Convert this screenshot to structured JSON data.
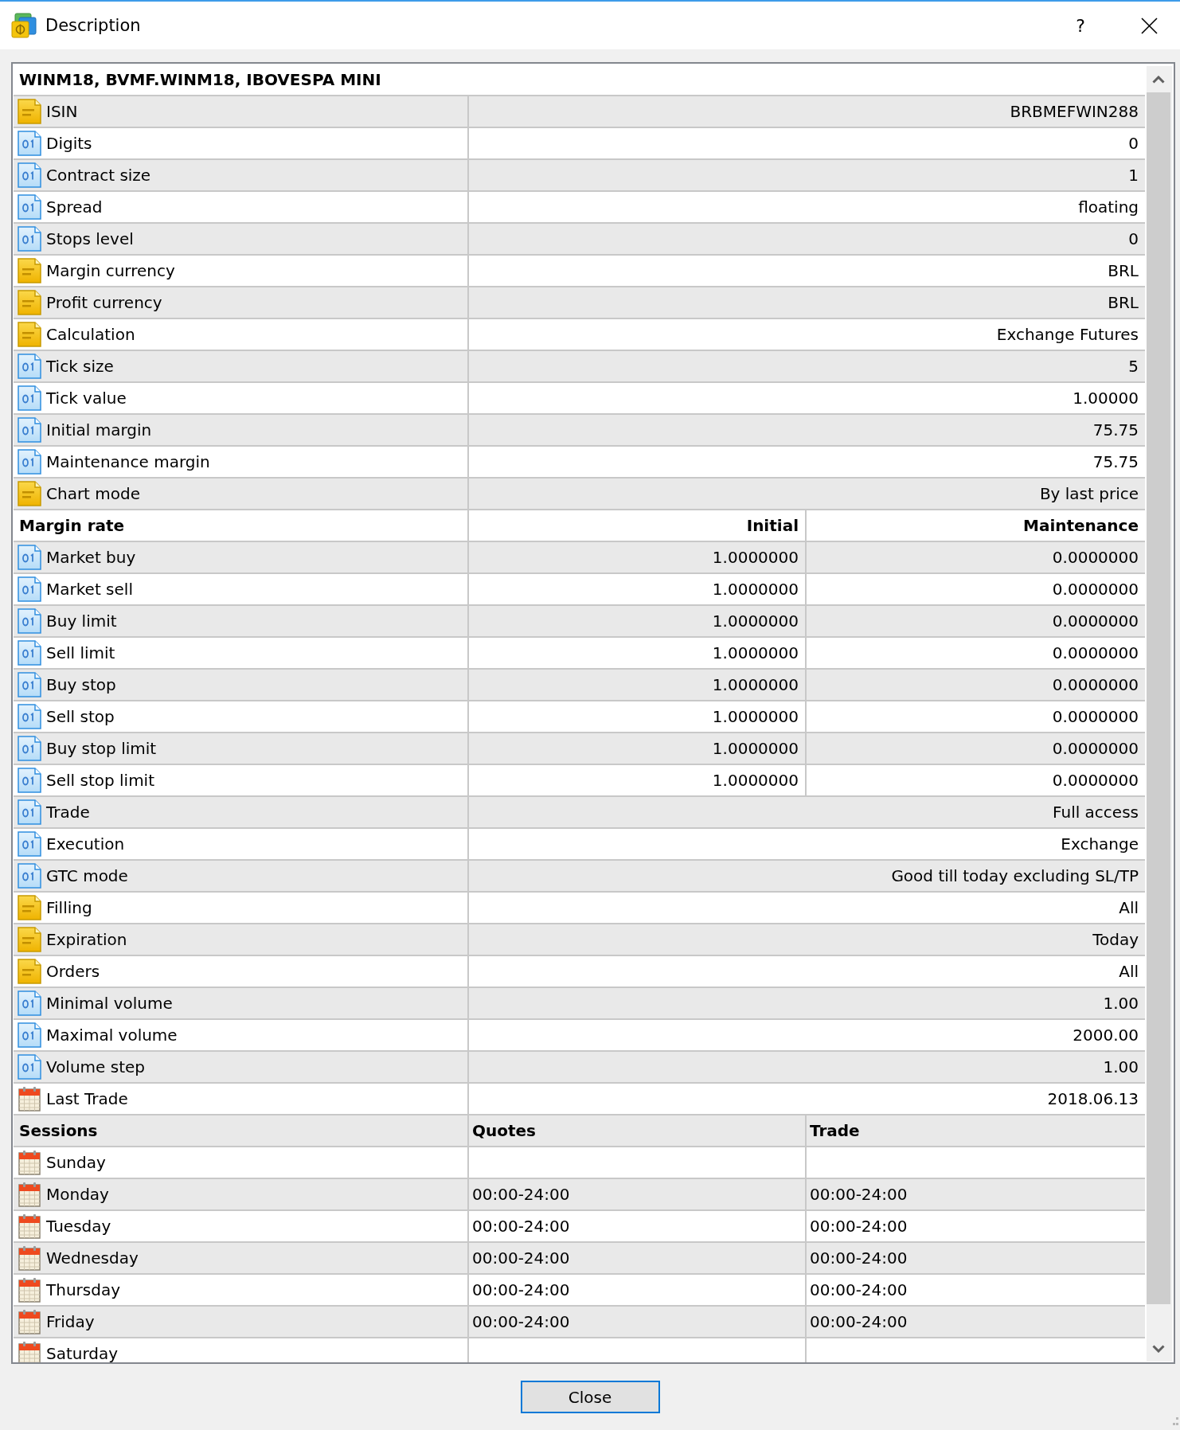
{
  "window": {
    "title": "Description",
    "help": "?"
  },
  "symbol_title": "WINM18, BVMF.WINM18, IBOVESPA MINI",
  "sections": [
    {
      "kind": "properties",
      "rows": [
        {
          "kind": "text",
          "label": "ISIN",
          "value": "BRBMEFWIN288"
        },
        {
          "kind": "number",
          "label": "Digits",
          "value": "0"
        },
        {
          "kind": "number",
          "label": "Contract size",
          "value": "1"
        },
        {
          "kind": "number",
          "label": "Spread",
          "value": "floating"
        },
        {
          "kind": "number",
          "label": "Stops level",
          "value": "0"
        },
        {
          "kind": "text",
          "label": "Margin currency",
          "value": "BRL"
        },
        {
          "kind": "text",
          "label": "Profit currency",
          "value": "BRL"
        },
        {
          "kind": "text",
          "label": "Calculation",
          "value": "Exchange Futures"
        },
        {
          "kind": "number",
          "label": "Tick size",
          "value": "5"
        },
        {
          "kind": "number",
          "label": "Tick value",
          "value": "1.00000"
        },
        {
          "kind": "number",
          "label": "Initial margin",
          "value": "75.75"
        },
        {
          "kind": "number",
          "label": "Maintenance margin",
          "value": "75.75"
        },
        {
          "kind": "text",
          "label": "Chart mode",
          "value": "By last price"
        }
      ]
    },
    {
      "kind": "margin_rates",
      "heading": "Margin rate",
      "columns": [
        "Initial",
        "Maintenance"
      ],
      "rows": [
        {
          "kind": "number",
          "label": "Market buy",
          "values": [
            "1.0000000",
            "0.0000000"
          ]
        },
        {
          "kind": "number",
          "label": "Market sell",
          "values": [
            "1.0000000",
            "0.0000000"
          ]
        },
        {
          "kind": "number",
          "label": "Buy limit",
          "values": [
            "1.0000000",
            "0.0000000"
          ]
        },
        {
          "kind": "number",
          "label": "Sell limit",
          "values": [
            "1.0000000",
            "0.0000000"
          ]
        },
        {
          "kind": "number",
          "label": "Buy stop",
          "values": [
            "1.0000000",
            "0.0000000"
          ]
        },
        {
          "kind": "number",
          "label": "Sell stop",
          "values": [
            "1.0000000",
            "0.0000000"
          ]
        },
        {
          "kind": "number",
          "label": "Buy stop limit",
          "values": [
            "1.0000000",
            "0.0000000"
          ]
        },
        {
          "kind": "number",
          "label": "Sell stop limit",
          "values": [
            "1.0000000",
            "0.0000000"
          ]
        }
      ]
    },
    {
      "kind": "properties",
      "rows": [
        {
          "kind": "number",
          "label": "Trade",
          "value": "Full access"
        },
        {
          "kind": "number",
          "label": "Execution",
          "value": "Exchange"
        },
        {
          "kind": "number",
          "label": "GTC mode",
          "value": "Good till today excluding SL/TP"
        },
        {
          "kind": "text",
          "label": "Filling",
          "value": "All"
        },
        {
          "kind": "text",
          "label": "Expiration",
          "value": "Today"
        },
        {
          "kind": "text",
          "label": "Orders",
          "value": "All"
        },
        {
          "kind": "number",
          "label": "Minimal volume",
          "value": "1.00"
        },
        {
          "kind": "number",
          "label": "Maximal volume",
          "value": "2000.00"
        },
        {
          "kind": "number",
          "label": "Volume step",
          "value": "1.00"
        },
        {
          "kind": "date",
          "label": "Last Trade",
          "value": "2018.06.13"
        }
      ]
    },
    {
      "kind": "sessions",
      "heading": "Sessions",
      "columns": [
        "Quotes",
        "Trade"
      ],
      "rows": [
        {
          "kind": "date",
          "label": "Sunday"
        },
        {
          "kind": "date",
          "label": "Monday",
          "values": [
            "00:00-24:00",
            "00:00-24:00"
          ]
        },
        {
          "kind": "date",
          "label": "Tuesday",
          "values": [
            "00:00-24:00",
            "00:00-24:00"
          ]
        },
        {
          "kind": "date",
          "label": "Wednesday",
          "values": [
            "00:00-24:00",
            "00:00-24:00"
          ]
        },
        {
          "kind": "date",
          "label": "Thursday",
          "values": [
            "00:00-24:00",
            "00:00-24:00"
          ]
        },
        {
          "kind": "date",
          "label": "Friday",
          "values": [
            "00:00-24:00",
            "00:00-24:00"
          ]
        },
        {
          "kind": "date",
          "label": "Saturday"
        }
      ]
    }
  ],
  "buttons": [
    {
      "label": "Close"
    }
  ]
}
